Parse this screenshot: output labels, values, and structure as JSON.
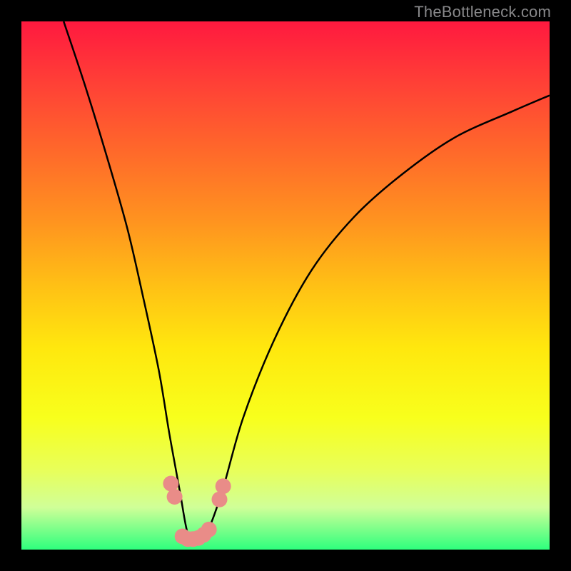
{
  "watermark": "TheBottleneck.com",
  "chart_data": {
    "type": "line",
    "title": "",
    "xlabel": "",
    "ylabel": "",
    "xlim": [
      0,
      100
    ],
    "ylim": [
      0,
      100
    ],
    "series": [
      {
        "name": "curve",
        "x": [
          8,
          12,
          16,
          20,
          23,
          26,
          28,
          30,
          31.5,
          33,
          35,
          38,
          42,
          48,
          55,
          63,
          72,
          82,
          93,
          100
        ],
        "values": [
          100,
          88,
          75,
          61,
          48,
          34,
          22,
          11,
          3,
          2,
          3,
          11,
          25,
          40,
          53,
          63,
          71,
          78,
          83,
          86
        ]
      }
    ],
    "markers": {
      "name": "highlight-dots",
      "color": "#e98c88",
      "points": [
        {
          "x": 28.3,
          "y": 12.5
        },
        {
          "x": 29.0,
          "y": 10.0
        },
        {
          "x": 30.5,
          "y": 2.5
        },
        {
          "x": 31.5,
          "y": 2.0
        },
        {
          "x": 32.5,
          "y": 2.0
        },
        {
          "x": 33.5,
          "y": 2.2
        },
        {
          "x": 34.5,
          "y": 2.8
        },
        {
          "x": 35.5,
          "y": 3.8
        },
        {
          "x": 37.5,
          "y": 9.5
        },
        {
          "x": 38.2,
          "y": 12.0
        }
      ]
    },
    "background": {
      "type": "vertical-gradient",
      "stops": [
        {
          "pos": 0.0,
          "color": "#ff193f"
        },
        {
          "pos": 0.5,
          "color": "#ffe80e"
        },
        {
          "pos": 1.0,
          "color": "#2eff7d"
        }
      ]
    }
  }
}
